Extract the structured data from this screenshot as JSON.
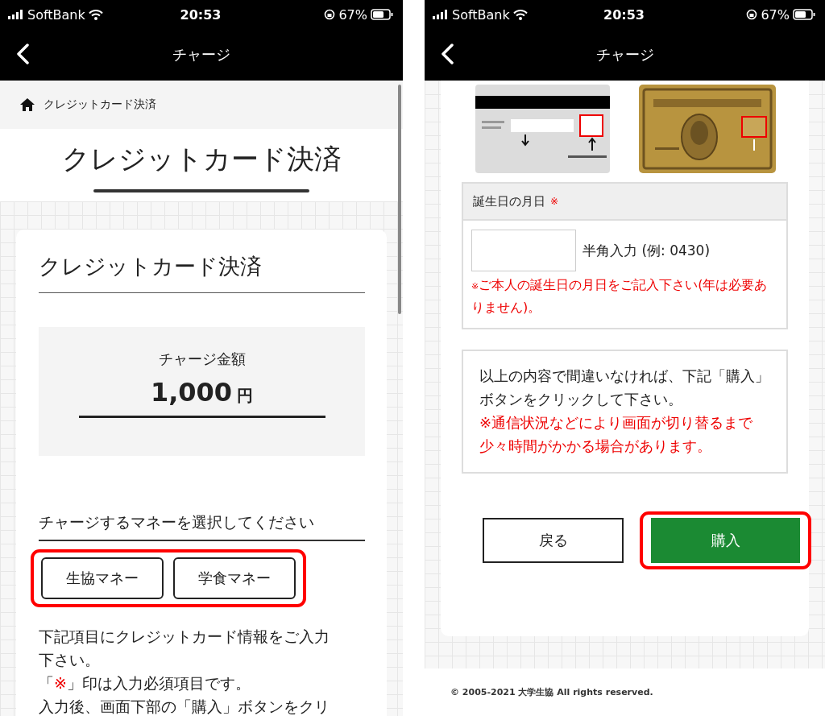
{
  "left_screen": {
    "status_bar": {
      "carrier": "SoftBank",
      "time": "20:53",
      "battery": "67%"
    },
    "nav": {
      "title": "チャージ"
    },
    "breadcrumb": "クレジットカード決済",
    "page_title": "クレジットカード決済",
    "section_title": "クレジットカード決済",
    "amount": {
      "label": "チャージ金額",
      "value": "1,000",
      "unit": "円"
    },
    "money_prompt": "チャージするマネーを選択してください",
    "money_options": {
      "highlighted": true,
      "items": [
        {
          "label": "生協マネー"
        },
        {
          "label": "学食マネー"
        }
      ]
    },
    "intro": "下記項目にクレジットカード情報をご入力下さい。",
    "required_note": {
      "before": "「",
      "mark": "※",
      "after": "」印は入力必須項目です。"
    },
    "after_note": "入力後、画面下部の「購入」ボタンをクリ"
  },
  "right_screen": {
    "status_bar": {
      "carrier": "SoftBank",
      "time": "20:53",
      "battery": "67%"
    },
    "nav": {
      "title": "チャージ"
    },
    "birthday": {
      "label": "誕生日の月日",
      "required_mark": "※",
      "hint": "半角入力 (例: 0430)",
      "note_mark": "※",
      "note": "ご本人の誕生日の月日をご記入下さい(年は必要ありません)。"
    },
    "confirmation": {
      "text": "以上の内容で間違いなければ、下記「購入」ボタンをクリックして下さい。",
      "warning": "※通信状況などにより画面が切り替るまで少々時間がかかる場合があります。"
    },
    "buttons": [
      {
        "label": "戻る",
        "kind": "secondary",
        "highlighted": false
      },
      {
        "label": "購入",
        "kind": "primary",
        "highlighted": true
      }
    ],
    "footer": "© 2005-2021 大学生協 All rights reserved."
  }
}
